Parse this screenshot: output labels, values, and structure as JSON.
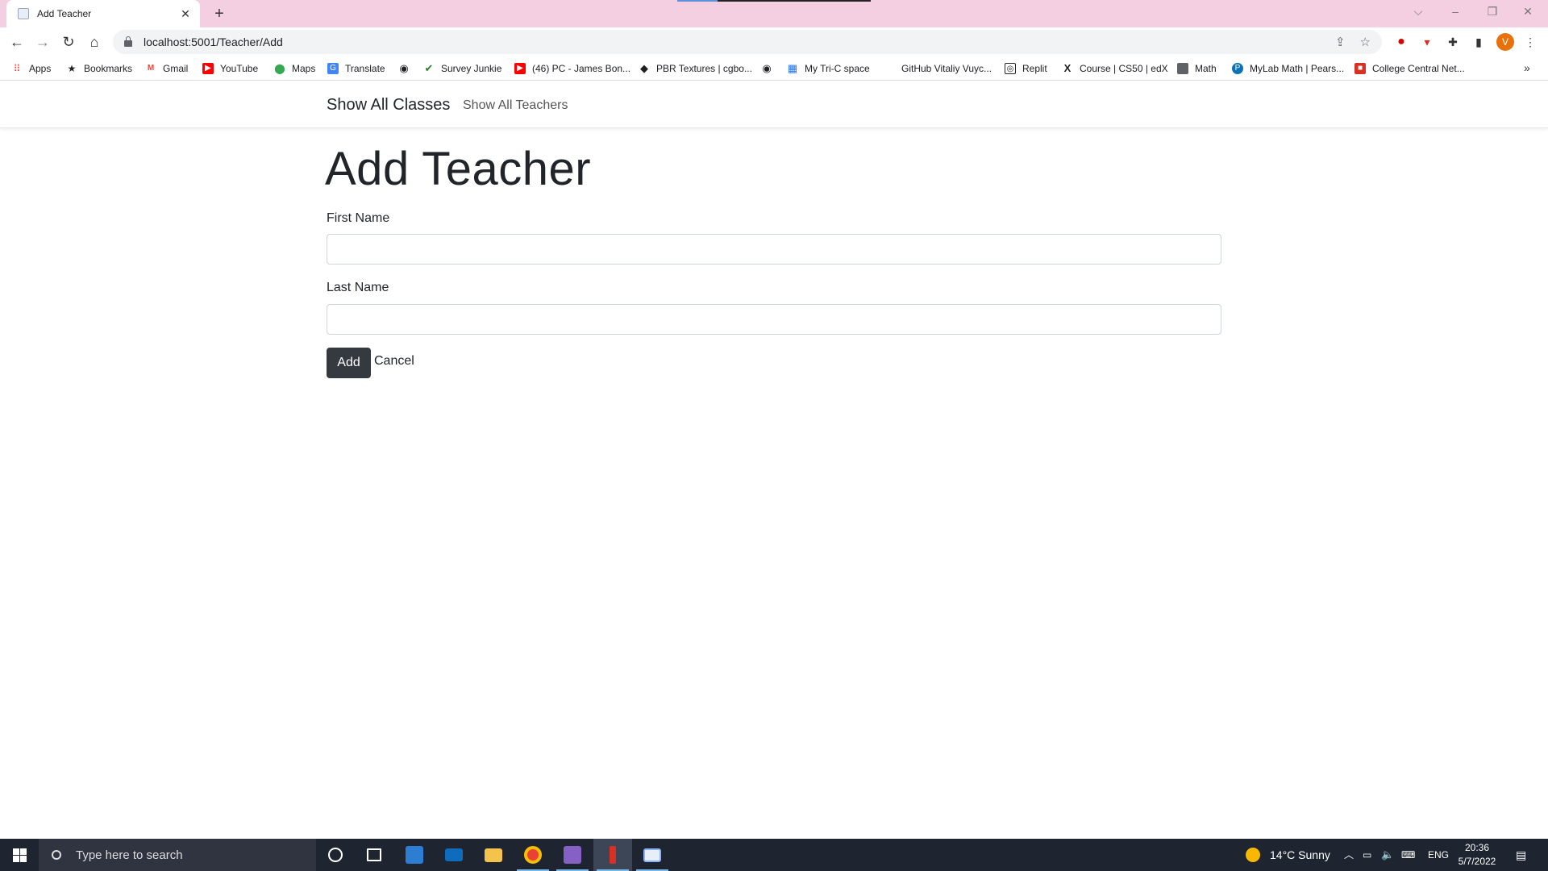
{
  "browser": {
    "tab_title": "Add Teacher",
    "url": "localhost:5001/Teacher/Add",
    "profile_initial": "V",
    "bookmarks": [
      {
        "label": "Apps",
        "icon": "apps-grid-icon",
        "color": "#ea4335"
      },
      {
        "label": "Bookmarks",
        "icon": "star-icon",
        "color": "#202124"
      },
      {
        "label": "Gmail",
        "icon": "gmail-icon",
        "color": "#ea4335"
      },
      {
        "label": "YouTube",
        "icon": "youtube-icon",
        "color": "#ff0000"
      },
      {
        "label": "Maps",
        "icon": "maps-pin-icon",
        "color": "#34a853"
      },
      {
        "label": "Translate",
        "icon": "translate-icon",
        "color": "#4285f4"
      },
      {
        "label": "",
        "icon": "globe-icon",
        "color": "#202124"
      },
      {
        "label": "Survey Junkie",
        "icon": "survey-junkie-icon",
        "color": "#2e7d32"
      },
      {
        "label": "(46) PC - James Bon...",
        "icon": "youtube-icon",
        "color": "#ff0000"
      },
      {
        "label": "PBR Textures | cgbo...",
        "icon": "cgbookcase-icon",
        "color": "#202124"
      },
      {
        "label": "",
        "icon": "globe-icon",
        "color": "#202124"
      },
      {
        "label": "My Tri-C space",
        "icon": "tri-c-icon",
        "color": "#1a73e8"
      },
      {
        "label": "GitHub Vitaliy Vuyc...",
        "icon": "",
        "color": "#ffffff"
      },
      {
        "label": "Replit",
        "icon": "replit-icon",
        "color": "#202124"
      },
      {
        "label": "Course | CS50 | edX",
        "icon": "edx-icon",
        "color": "#202124"
      },
      {
        "label": "Math",
        "icon": "document-icon",
        "color": "#5f6368"
      },
      {
        "label": "MyLab Math | Pears...",
        "icon": "pearson-icon",
        "color": "#0b72b5"
      },
      {
        "label": "College Central Net...",
        "icon": "college-central-icon",
        "color": "#d93025"
      }
    ]
  },
  "nav": {
    "brand": "Show All Classes",
    "link": "Show All Teachers"
  },
  "page": {
    "title": "Add Teacher",
    "first_name_label": "First Name",
    "first_name_value": "",
    "last_name_label": "Last Name",
    "last_name_value": "",
    "add_label": "Add",
    "cancel_label": "Cancel"
  },
  "taskbar": {
    "search_placeholder": "Type here to search",
    "weather": "14°C  Sunny",
    "language": "ENG",
    "time": "20:36",
    "date": "5/7/2022"
  },
  "colors": {
    "titlebar": "#f3cfe1",
    "button_dark": "#343a40",
    "taskbar": "#1f2530"
  }
}
